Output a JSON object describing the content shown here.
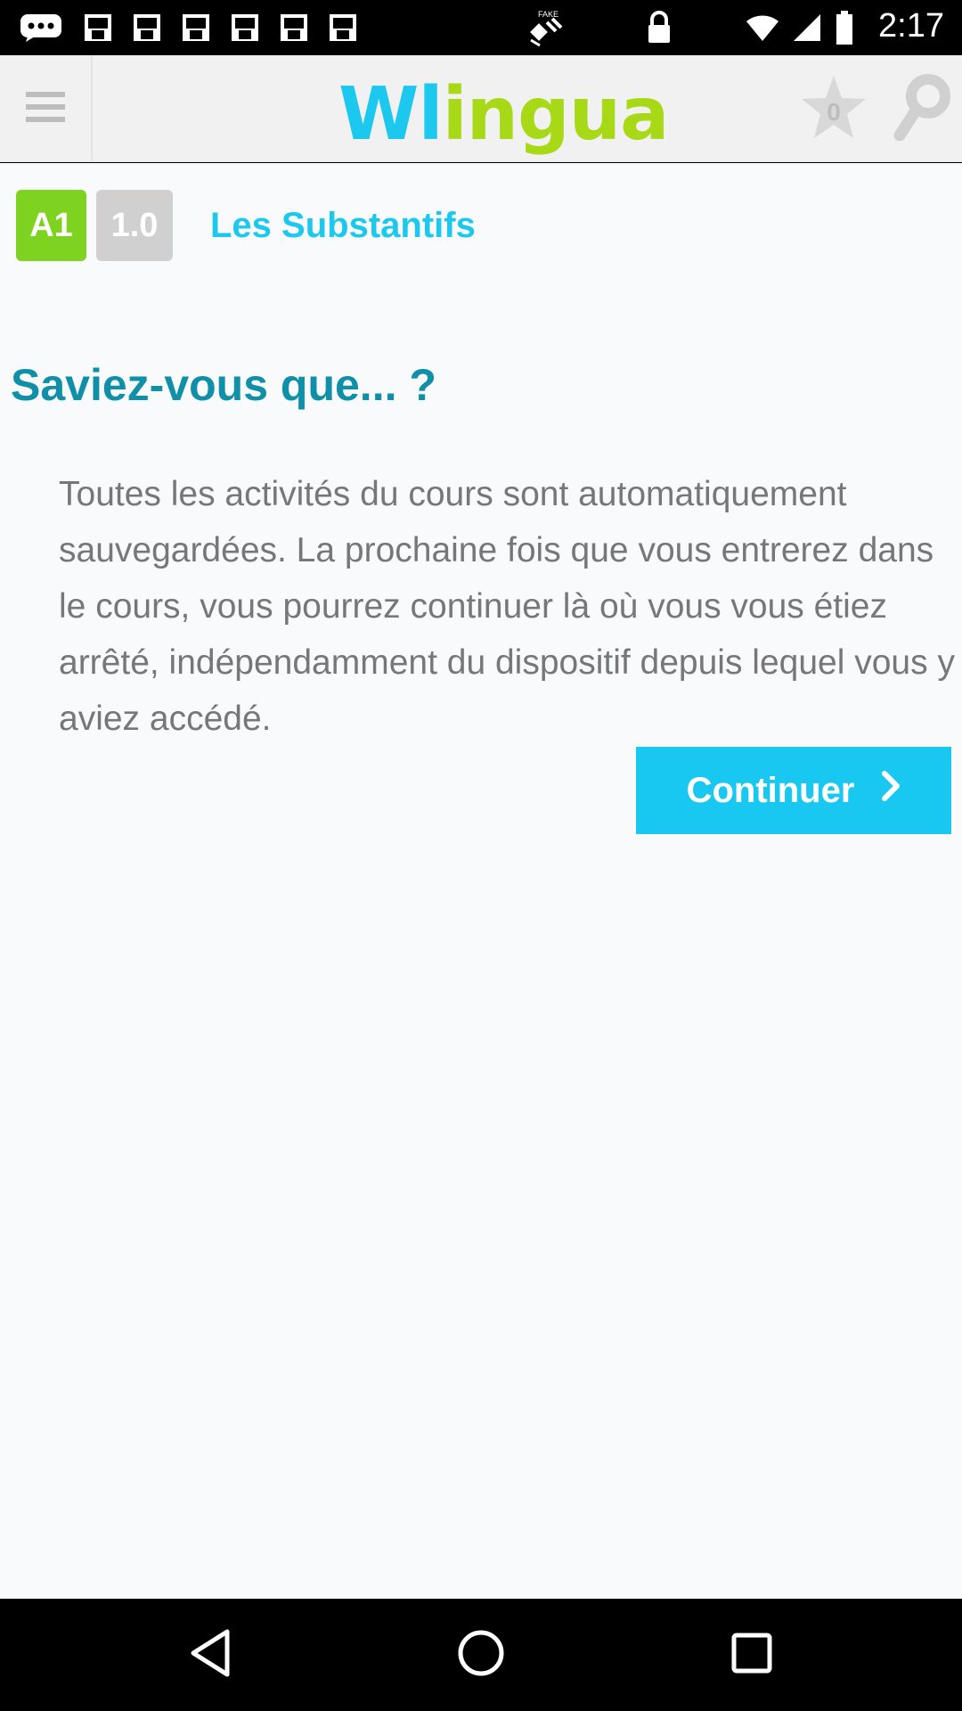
{
  "status_bar": {
    "time": "2:17",
    "icons": [
      "message-icon",
      "image-icon",
      "image-icon",
      "image-icon",
      "image-icon",
      "image-icon",
      "mock-location-icon",
      "lock-icon"
    ],
    "fake_label": "FAKE"
  },
  "header": {
    "logo_text": {
      "w": "W",
      "l": "l",
      "i": "i",
      "ngua": "ngua"
    },
    "star_count": "0"
  },
  "lesson": {
    "level_badge": "A1",
    "version_badge": "1.0",
    "title": "Les Substantifs"
  },
  "tip": {
    "heading": "Saviez-vous que... ?",
    "text": "Toutes les activités du cours sont automatiquement sauvegardées. La prochaine fois que vous entrerez dans le cours, vous pourrez continuer là où vous vous étiez arrêté, indépendamment du dispositif depuis lequel vous y aviez accédé.",
    "continue_label": "Continuer"
  },
  "colors": {
    "brand_blue": "#1cc8ee",
    "brand_green": "#a8d916",
    "level_green": "#7ed321",
    "heading_teal": "#0f8fa8"
  }
}
